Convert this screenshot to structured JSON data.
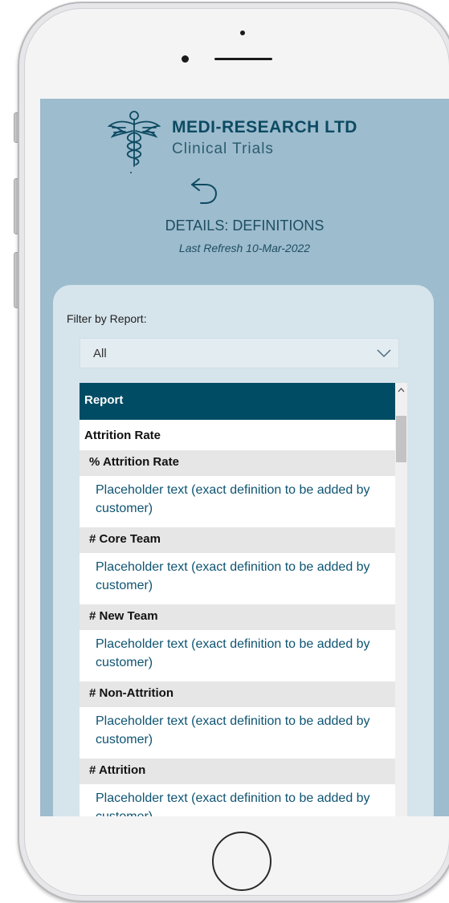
{
  "brand": {
    "name": "MEDI-RESEARCH LTD",
    "subtitle": "Clinical Trials"
  },
  "page": {
    "title": "DETAILS: DEFINITIONS",
    "refresh": "Last Refresh 10-Mar-2022"
  },
  "filter": {
    "label": "Filter by Report:",
    "selected": "All"
  },
  "table": {
    "header": "Report",
    "group": "Attrition Rate",
    "items": [
      {
        "name": "% Attrition Rate",
        "definition": "Placeholder text (exact definition to be added by customer)"
      },
      {
        "name": "# Core Team",
        "definition": "Placeholder text (exact definition to be added by customer)"
      },
      {
        "name": "# New Team",
        "definition": "Placeholder text (exact definition to be added by customer)"
      },
      {
        "name": "# Non-Attrition",
        "definition": "Placeholder text (exact definition to be added by customer)"
      },
      {
        "name": "# Attrition",
        "definition": "Placeholder text (exact definition to be added by customer)"
      }
    ]
  },
  "colors": {
    "screen_bg": "#9dbccd",
    "card_bg": "#d6e4ec",
    "header_bg": "#004c64",
    "brand_text": "#0d4a63",
    "definition_text": "#0e5472"
  },
  "icons": {
    "logo": "caduceus-icon",
    "back": "back-arrow-icon",
    "dropdown": "chevron-down-icon",
    "scroll_up": "chevron-up-icon"
  }
}
